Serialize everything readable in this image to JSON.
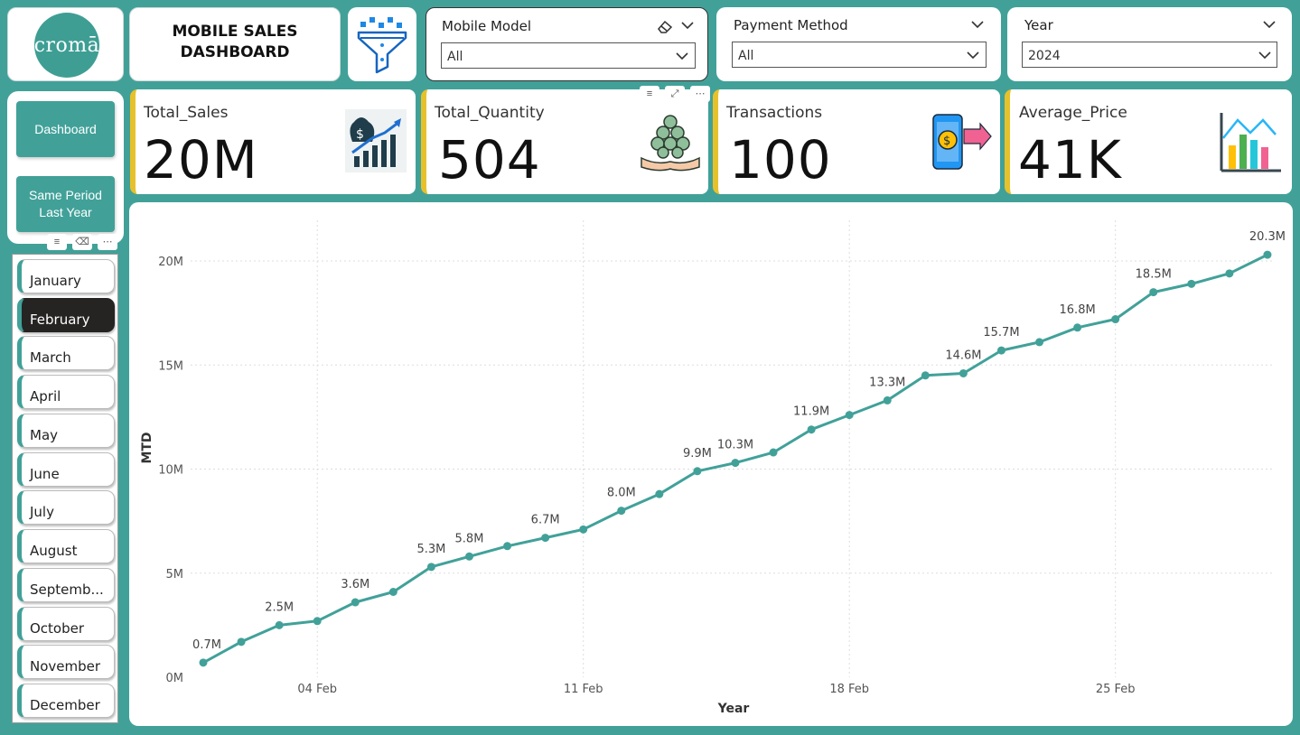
{
  "logo": {
    "text": "cromā"
  },
  "title": {
    "line1": "MOBILE SALES",
    "line2": "DASHBOARD"
  },
  "slicers": {
    "mobile_model": {
      "label": "Mobile Model",
      "value": "All"
    },
    "payment_method": {
      "label": "Payment Method",
      "value": "All"
    },
    "year": {
      "label": "Year",
      "value": "2024"
    }
  },
  "nav": {
    "dashboard": "Dashboard",
    "spl_line1": "Same Period",
    "spl_line2": "Last Year"
  },
  "months": [
    "January",
    "February",
    "March",
    "April",
    "May",
    "June",
    "July",
    "August",
    "Septemb...",
    "October",
    "November",
    "December"
  ],
  "selected_month": "February",
  "kpis": [
    {
      "label": "Total_Sales",
      "value": "20M",
      "icon": "money-bag-growth-icon"
    },
    {
      "label": "Total_Quantity",
      "value": "504",
      "icon": "coins-hands-icon"
    },
    {
      "label": "Transactions",
      "value": "100",
      "icon": "phone-payment-icon"
    },
    {
      "label": "Average_Price",
      "value": "41K",
      "icon": "bar-chart-icon"
    }
  ],
  "colors": {
    "teal": "#41A199",
    "kpi_accent": "#E7C12B",
    "line": "#41A199"
  },
  "chart_data": {
    "type": "line",
    "xlabel": "Year",
    "ylabel": "MTD",
    "ylim": [
      0,
      20
    ],
    "yticks": [
      "0M",
      "5M",
      "10M",
      "15M",
      "20M"
    ],
    "xticks": [
      "04 Feb",
      "11 Feb",
      "18 Feb",
      "25 Feb"
    ],
    "x": [
      1,
      2,
      3,
      4,
      5,
      6,
      7,
      8,
      9,
      10,
      11,
      12,
      13,
      14,
      15,
      16,
      17,
      18,
      19,
      20,
      21,
      22,
      23,
      24,
      25,
      26,
      27,
      28,
      29
    ],
    "values": [
      0.7,
      1.7,
      2.5,
      2.7,
      3.6,
      4.1,
      5.3,
      5.8,
      6.3,
      6.7,
      7.1,
      8.0,
      8.8,
      9.9,
      10.3,
      10.8,
      11.9,
      12.6,
      13.3,
      14.5,
      14.6,
      15.7,
      16.1,
      16.8,
      17.2,
      18.5,
      18.9,
      19.4,
      20.3
    ],
    "labels": [
      "0.7M",
      "",
      "2.5M",
      "",
      "3.6M",
      "",
      "5.3M",
      "5.8M",
      "",
      "6.7M",
      "",
      "8.0M",
      "",
      "9.9M",
      "10.3M",
      "",
      "11.9M",
      "",
      "13.3M",
      "",
      "14.6M",
      "15.7M",
      "",
      "16.8M",
      "",
      "18.5M",
      "",
      "",
      "20.3M"
    ],
    "grid": true
  }
}
